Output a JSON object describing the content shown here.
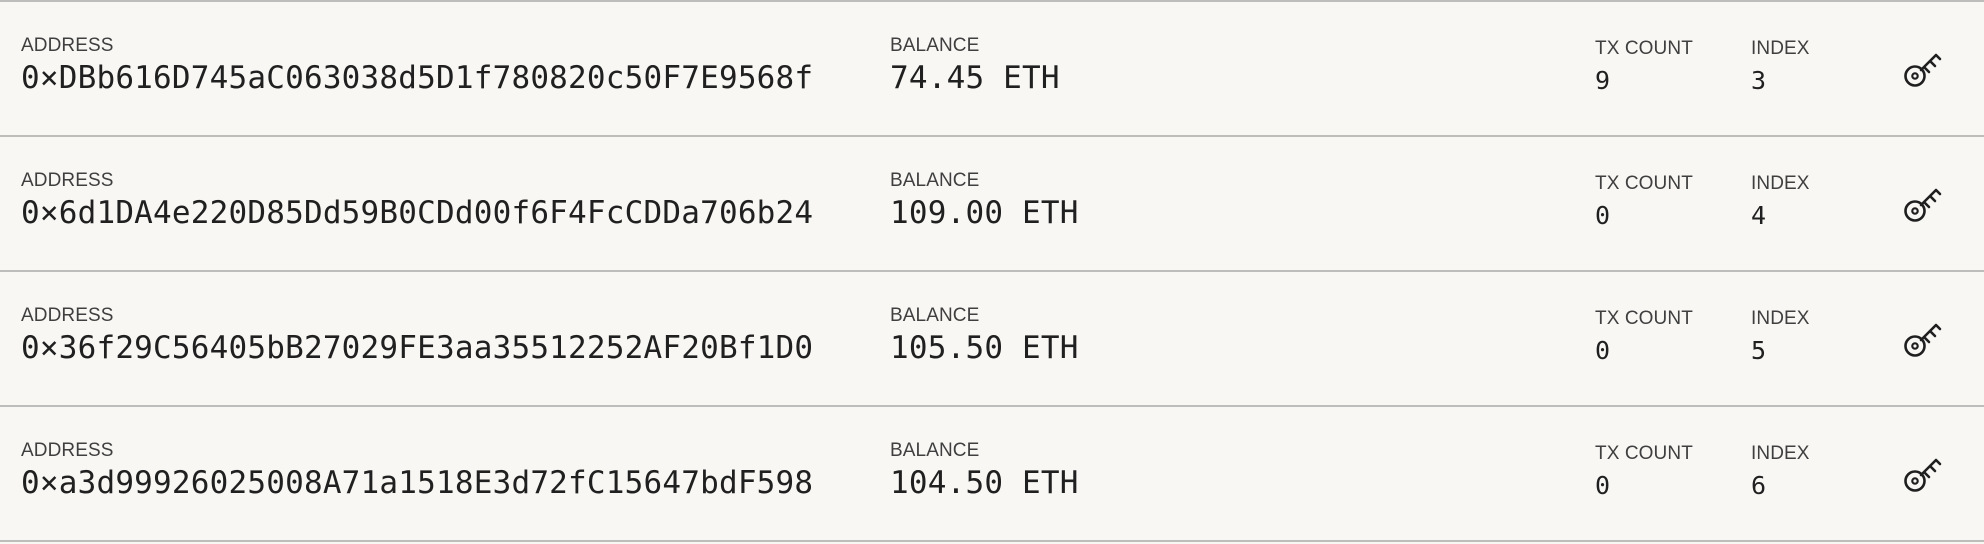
{
  "labels": {
    "address": "ADDRESS",
    "balance": "BALANCE",
    "tx_count": "TX COUNT",
    "index": "INDEX"
  },
  "accounts": [
    {
      "address": "0×DBb616D745aC063038d5D1f780820c50F7E9568f",
      "balance": "74.45 ETH",
      "tx_count": "9",
      "index": "3",
      "key_icon": "key-icon"
    },
    {
      "address": "0×6d1DA4e220D85Dd59B0CDd00f6F4FcCDDa706b24",
      "balance": "109.00 ETH",
      "tx_count": "0",
      "index": "4",
      "key_icon": "key-icon"
    },
    {
      "address": "0×36f29C56405bB27029FE3aa35512252AF20Bf1D0",
      "balance": "105.50 ETH",
      "tx_count": "0",
      "index": "5",
      "key_icon": "key-icon"
    },
    {
      "address": "0×a3d99926025008A71a1518E3d72fC15647bdF598",
      "balance": "104.50 ETH",
      "tx_count": "0",
      "index": "6",
      "key_icon": "key-icon"
    }
  ],
  "colors": {
    "background": "#f8f7f4",
    "divider": "#bdbdbb",
    "text": "#202020",
    "label": "#3f3f3f"
  }
}
